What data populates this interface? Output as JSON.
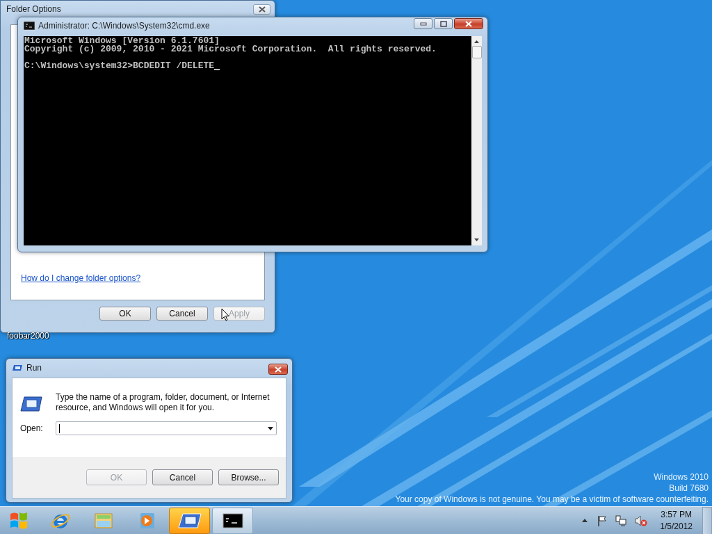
{
  "folder_options": {
    "title": "Folder Options",
    "help_link": "How do I change folder options?",
    "buttons": [
      {
        "label": "OK",
        "disabled": false
      },
      {
        "label": "Cancel",
        "disabled": false
      },
      {
        "label": "Apply",
        "disabled": true
      }
    ]
  },
  "desktop_icons": [
    {
      "label": "foobar2000"
    }
  ],
  "cmd": {
    "title": "Administrator: C:\\Windows\\System32\\cmd.exe",
    "output": [
      "Microsoft Windows [Version 6.1.7601]",
      "Copyright (c) 2009, 2010 - 2021 Microsoft Corporation.  All rights reserved."
    ],
    "prompt": "C:\\Windows\\system32>BCDEDIT /DELETE"
  },
  "run": {
    "title": "Run",
    "description": "Type the name of a program, folder, document, or Internet resource, and Windows will open it for you.",
    "open_label": "Open:",
    "buttons": [
      {
        "label": "OK",
        "disabled": true
      },
      {
        "label": "Cancel",
        "disabled": false
      },
      {
        "label": "Browse...",
        "disabled": false
      }
    ]
  },
  "desktop_notice": [
    "Windows 2010",
    "Build 7680",
    "Your copy of Windows is not genuine. You may be a victim of software counterfeiting."
  ],
  "taskbar": {
    "items": [
      {
        "kind": "browser",
        "running": false,
        "flashing": false
      },
      {
        "kind": "folder",
        "running": false,
        "flashing": false
      },
      {
        "kind": "media",
        "running": false,
        "flashing": false
      },
      {
        "kind": "run",
        "running": true,
        "flashing": true
      },
      {
        "kind": "console",
        "running": true,
        "flashing": false
      }
    ],
    "tray_icons": [
      {
        "kind": "flag"
      },
      {
        "kind": "network"
      },
      {
        "kind": "volume",
        "muted": true
      }
    ],
    "clock": {
      "time": "3:57 PM",
      "date": "1/5/2012"
    }
  }
}
